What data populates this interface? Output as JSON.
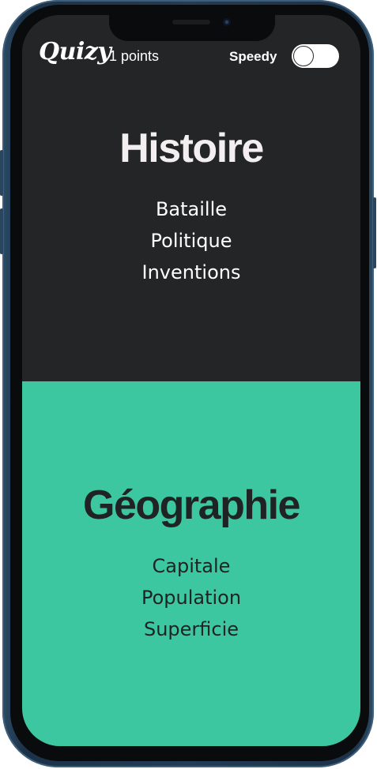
{
  "header": {
    "logo": "Quizy",
    "points": "1 points",
    "speedy_label": "Speedy",
    "speedy_enabled": false
  },
  "categories": [
    {
      "title": "Histoire",
      "color": "#232526",
      "text_color": "#f3eeef",
      "subtopics": [
        "Bataille",
        "Politique",
        "Inventions"
      ]
    },
    {
      "title": "Géographie",
      "color": "#3cc7a1",
      "text_color": "#1f2324",
      "subtopics": [
        "Capitale",
        "Population",
        "Superficie"
      ]
    }
  ]
}
